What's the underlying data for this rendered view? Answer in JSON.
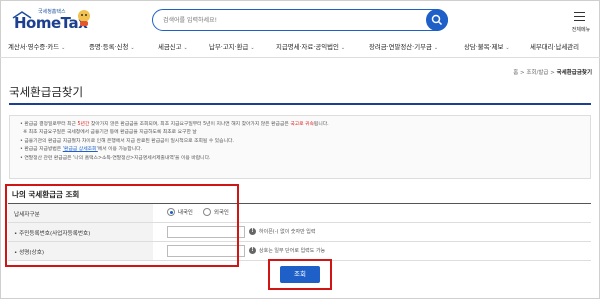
{
  "header": {
    "logo_small": "국세청홈택스",
    "logo_text": "HomeTax",
    "search_placeholder": "검색어를 입력하세요!",
    "menu_label": "전체메뉴"
  },
  "nav": [
    {
      "label": "계산서·영수증·카드"
    },
    {
      "label": "증명·등록·신청"
    },
    {
      "label": "세금신고"
    },
    {
      "label": "납부·고지·환급"
    },
    {
      "label": "지급명세·자료·공익법인"
    },
    {
      "label": "장려금·연말정산·기부금"
    },
    {
      "label": "상담·불복·제보"
    },
    {
      "label": "세무대리·납세관리"
    }
  ],
  "breadcrumb": {
    "home": "홈",
    "parent": "조회/발급",
    "current": "국세환급금찾기"
  },
  "page_title": "국세환급금찾기",
  "notice": {
    "line1_a": "환급금 결정일로부터 최근 ",
    "line1_red": "5년간",
    "line1_b": " 찾아가지 않은 환급금을 조회되며, 최초 지급요구일부터 5년이 지나면 해지 찾아가지 않은 환급금은 ",
    "line1_red2": "국고로 귀속",
    "line1_c": "됩니다.",
    "line2": "※ 최초 지급요구일은 국세청에서 금융기관 등에 환급금을 지급하도록 최초로 요구한 날",
    "line3": "금융기관의 환급금 지급절차 차이로 인해 은행에서 지급 완료된 환급금이 일시적으로 조회될 수 있습니다.",
    "line4_a": "환급금 지급방법은 ",
    "line4_link": "'환급금 상세조회'",
    "line4_b": "에서 이용 가능합니다.",
    "line5": "연말정산 관련 환급금은 '나의 홈택스>소득·연말정산>지급명세서제출내역'을 이용 바랍니다."
  },
  "form": {
    "section_title": "나의 국세환급금 조회",
    "taxpayer_type_label": "납세자구분",
    "radio_domestic": "내국인",
    "radio_foreign": "외국인",
    "id_label": "• 주민등록번호(사업자등록번호)",
    "id_hint": "하이픈(-) 없이 숫자만 입력",
    "name_label": "• 성명(상호)",
    "name_hint": "상호는 일부 단어로 입력도 가능"
  },
  "submit_label": "조회",
  "colors": {
    "brand_blue": "#1e5fc8",
    "highlight_red": "#d01515"
  }
}
